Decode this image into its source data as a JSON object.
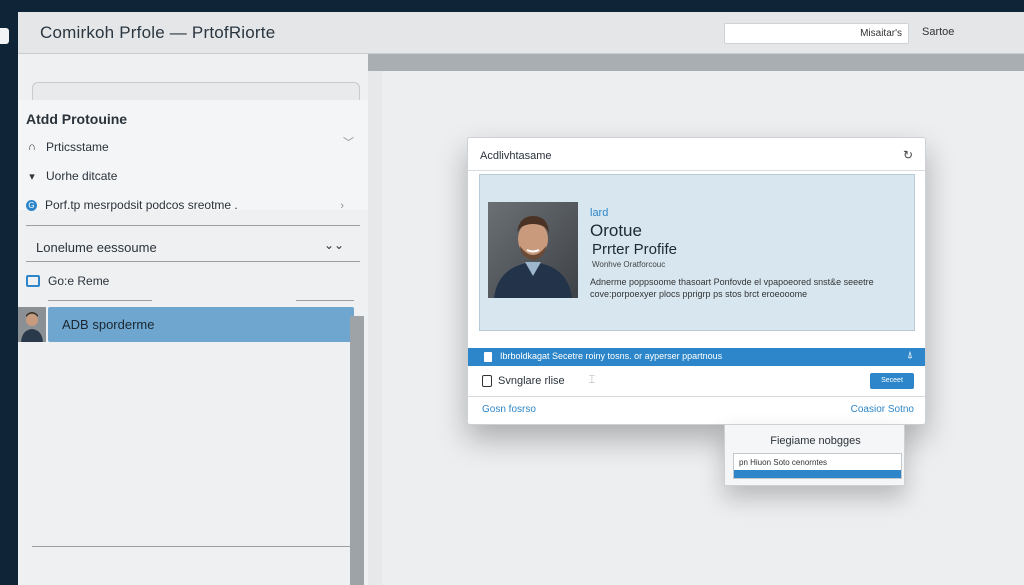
{
  "app": {
    "title": "Comirkoh Prfole  —  PrtofRiorte",
    "search_value": "Misaitar's",
    "search_label": "Sartoe"
  },
  "sidebar": {
    "title": "Atdd Protouine",
    "items": [
      {
        "label": "Prticsstame",
        "icon": "headset-icon"
      },
      {
        "label": "Uorhe ditcate",
        "icon": "caret-down-icon"
      },
      {
        "label": "Porf.tp mesrpodsit podcos sreotme .",
        "icon": "info-icon"
      }
    ],
    "dropdown_label": "Lonelume eessoume",
    "section_label": "Go:e Reme",
    "active_item": "ADB sporderme"
  },
  "dialog": {
    "title": "Acdlivhtasame",
    "card": {
      "tag": "lard",
      "name": "Orotue",
      "subtitle": "Prrter Profife",
      "meta": "Wonhve Oratforcouc",
      "description": "Adnerme poppsoome thasoart Ponfovde el vpapoeored snst&e seeetre cove:porpoexyer plocs pprigrp ps stos brct eroeooome"
    },
    "info_text": "Ibrboldkagat Secetre roiny tosns. or ayperser ppartnous",
    "field_label": "Svnglare rlise",
    "primary_button": "Seceet",
    "link_left": "Gosn fosrso",
    "link_right": "Coasior Sotno"
  },
  "popup": {
    "title": "Fiegiame nobgges",
    "input_value": "pn Hiuon Soto cenorntes"
  },
  "colors": {
    "accent": "#2d86c9",
    "titlebar_dark": "#0f2437",
    "sidebar_active": "#6fa6cf",
    "card_bg": "#d7e6ef"
  }
}
